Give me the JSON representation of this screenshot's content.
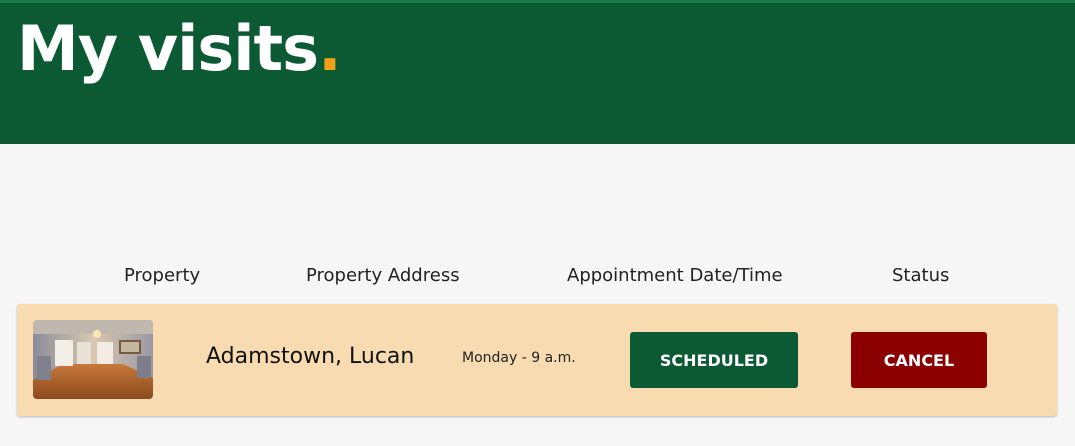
{
  "header": {
    "title": "My visits",
    "title_dot": ".",
    "background": "#0b5a33",
    "accent": "#f2a11b"
  },
  "table": {
    "columns": [
      "Property",
      "Property Address",
      "Appointment Date/Time",
      "Status"
    ]
  },
  "visits": [
    {
      "image_icon": "property-photo",
      "address": "Adamstown, Lucan",
      "datetime": "Monday - 9 a.m.",
      "status": "SCHEDULED",
      "action": "CANCEL",
      "row_color": "#f8dbb0",
      "status_color": "#0b5a33",
      "action_color": "#8b0000"
    }
  ]
}
